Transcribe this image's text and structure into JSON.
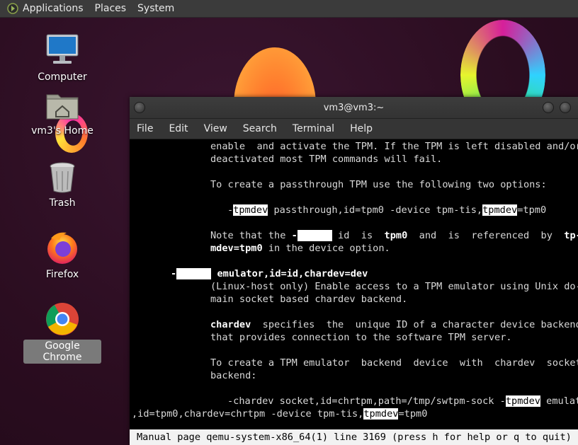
{
  "panel": {
    "menus": [
      "Applications",
      "Places",
      "System"
    ]
  },
  "desktop": {
    "icons": [
      {
        "label": "Computer",
        "icon": "computer-icon"
      },
      {
        "label": "vm3's Home",
        "icon": "home-folder-icon"
      },
      {
        "label": "Trash",
        "icon": "trash-icon"
      },
      {
        "label": "Firefox",
        "icon": "firefox-icon"
      },
      {
        "label": "Google Chrome",
        "icon": "chrome-icon"
      }
    ]
  },
  "terminal": {
    "title": "vm3@vm3:~",
    "menus": [
      "File",
      "Edit",
      "View",
      "Search",
      "Terminal",
      "Help"
    ],
    "status": "Manual page qemu-system-x86_64(1) line 3169 (press h for help or q to quit)"
  },
  "colors": {
    "panel": "#3b3b3b",
    "desktop": "#2c0f22",
    "terminal_bg": "#000000",
    "highlight_bg": "#ffffff"
  }
}
